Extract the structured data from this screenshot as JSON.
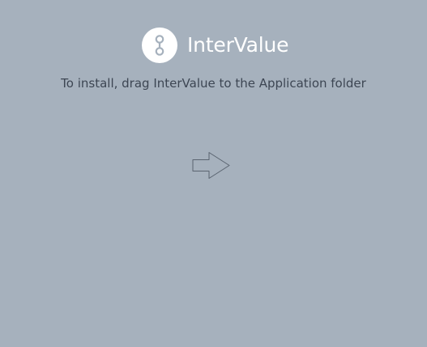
{
  "header": {
    "app_name": "InterValue",
    "logo_icon": "intervalue-logo-icon"
  },
  "instructions": {
    "text": "To install, drag InterValue to the Application folder"
  },
  "drag_arrow": {
    "icon": "arrow-right-icon"
  },
  "colors": {
    "background": "#a6b1bd",
    "logo_text": "#ffffff",
    "instruction_text": "#3d4653",
    "arrow_stroke": "#5a6470"
  }
}
